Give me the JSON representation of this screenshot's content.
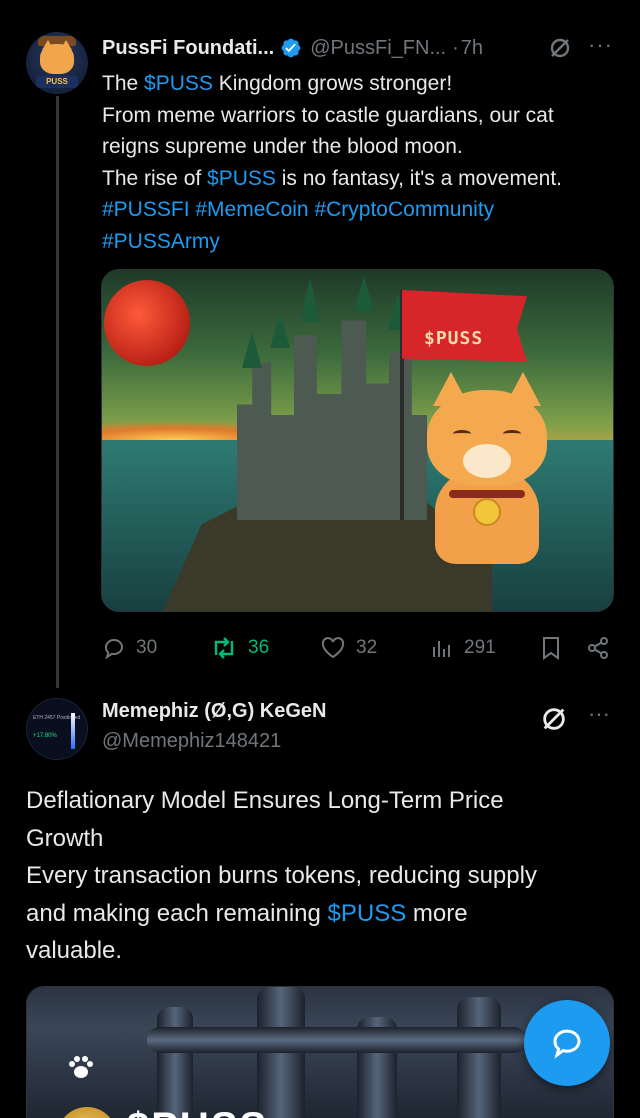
{
  "tweet1": {
    "author_name": "PussFi Foundati...",
    "handle": "@PussFi_FN...",
    "separator": "·",
    "time": "7h",
    "avatar_label": "PUSS",
    "lines": [
      [
        {
          "t": "The ",
          "link": false
        },
        {
          "t": "$PUSS",
          "link": true
        },
        {
          "t": " Kingdom grows stronger!",
          "link": false
        }
      ],
      [
        {
          "t": "From meme warriors to castle guardians, our cat",
          "link": false
        }
      ],
      [
        {
          "t": "reigns supreme under the blood moon.",
          "link": false
        }
      ],
      [
        {
          "t": "The rise of ",
          "link": false
        },
        {
          "t": "$PUSS",
          "link": true
        },
        {
          "t": " is no fantasy,  it's a movement.",
          "link": false
        }
      ],
      [
        {
          "t": "#PUSSFI",
          "link": true
        },
        {
          "t": " ",
          "link": false
        },
        {
          "t": "#MemeCoin",
          "link": true
        },
        {
          "t": " ",
          "link": false
        },
        {
          "t": "#CryptoCommunity",
          "link": true
        }
      ],
      [
        {
          "t": "#PUSSArmy",
          "link": true
        }
      ]
    ],
    "media_flag_text": "$PUSS",
    "replies": "30",
    "reposts": "36",
    "likes": "32",
    "views": "291"
  },
  "tweet2": {
    "author_name": "Memephiz (Ø,G) KeGeN",
    "handle": "@Memephiz148421",
    "avatar_text_top": "ETH 2457 Positioned",
    "avatar_text_pct": "+17.80%",
    "lines": [
      [
        {
          "t": "Deflationary Model Ensures Long-Term Price",
          "link": false
        }
      ],
      [
        {
          "t": "Growth",
          "link": false
        }
      ],
      [
        {
          "t": "Every transaction burns tokens, reducing supply",
          "link": false
        }
      ],
      [
        {
          "t": "and making each remaining ",
          "link": false
        },
        {
          "t": "$PUSS",
          "link": true
        },
        {
          "t": " more",
          "link": false
        }
      ],
      [
        {
          "t": "valuable.",
          "link": false
        }
      ]
    ],
    "media_title": "$PUSS"
  },
  "colors": {
    "background": "#000000",
    "text": "#e7e9ea",
    "muted": "#71767b",
    "link": "#1d9bf0",
    "repost_active": "#00ba7c"
  },
  "icons": [
    "verified-badge-icon",
    "grok-icon",
    "more-icon",
    "reply-icon",
    "repost-icon",
    "like-icon",
    "views-icon",
    "bookmark-icon",
    "share-icon",
    "paw-icon",
    "compose-icon"
  ]
}
